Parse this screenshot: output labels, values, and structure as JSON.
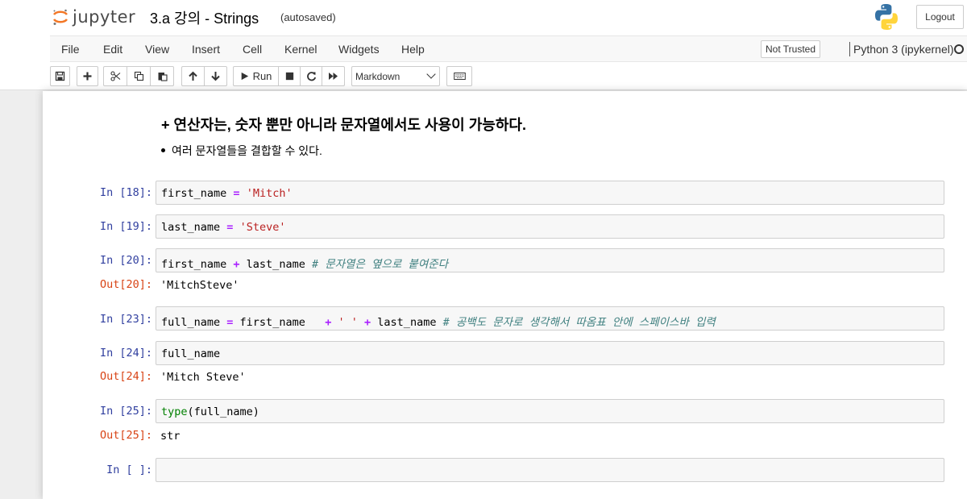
{
  "header": {
    "logo_text": "jupyter",
    "notebook_title": "3.a 강의 - Strings",
    "autosave_status": "(autosaved)",
    "logout_label": "Logout"
  },
  "menubar": {
    "items": [
      "File",
      "Edit",
      "View",
      "Insert",
      "Cell",
      "Kernel",
      "Widgets",
      "Help"
    ],
    "trust_status": "Not Trusted",
    "kernel_name": "Python 3 (ipykernel)"
  },
  "toolbar": {
    "buttons": [
      "save-icon",
      "add-icon",
      "cut-icon",
      "copy-icon",
      "paste-icon",
      "move-up-icon",
      "move-down-icon",
      "run-icon",
      "stop-icon",
      "restart-icon",
      "fast-forward-icon",
      "keyboard-icon"
    ],
    "run_label": "Run",
    "cell_type": "Markdown"
  },
  "markdown": {
    "heading": "+ 연산자는, 숫자 뿐만 아니라 문자열에서도 사용이 가능하다.",
    "bullet": "여러 문자열들을 결합할 수 있다."
  },
  "cells": [
    {
      "prompt": "In [18]:",
      "code": [
        {
          "text": "first_name ",
          "type": "plain"
        },
        {
          "text": "=",
          "type": "op"
        },
        {
          "text": " ",
          "type": "plain"
        },
        {
          "text": "'Mitch'",
          "type": "str"
        }
      ]
    },
    {
      "prompt": "In [19]:",
      "code": [
        {
          "text": "last_name ",
          "type": "plain"
        },
        {
          "text": "=",
          "type": "op"
        },
        {
          "text": " ",
          "type": "plain"
        },
        {
          "text": "'Steve'",
          "type": "str"
        }
      ]
    },
    {
      "prompt": "In [20]:",
      "code": [
        {
          "text": "first_name ",
          "type": "plain"
        },
        {
          "text": "+",
          "type": "op"
        },
        {
          "text": " last_name ",
          "type": "plain"
        },
        {
          "text": "# 문자열은 옆으로 붙여준다",
          "type": "comment"
        }
      ],
      "out_prompt": "Out[20]:",
      "output": "'MitchSteve'"
    },
    {
      "prompt": "In [23]:",
      "code": [
        {
          "text": "full_name ",
          "type": "plain"
        },
        {
          "text": "=",
          "type": "op"
        },
        {
          "text": " first_name   ",
          "type": "plain"
        },
        {
          "text": "+",
          "type": "op"
        },
        {
          "text": " ",
          "type": "plain"
        },
        {
          "text": "' '",
          "type": "str"
        },
        {
          "text": " ",
          "type": "plain"
        },
        {
          "text": "+",
          "type": "op"
        },
        {
          "text": " last_name ",
          "type": "plain"
        },
        {
          "text": "# 공백도 문자로 생각해서 따옴표 안에 스페이스바 입력",
          "type": "comment"
        }
      ]
    },
    {
      "prompt": "In [24]:",
      "code": [
        {
          "text": "full_name",
          "type": "plain"
        }
      ],
      "out_prompt": "Out[24]:",
      "output": "'Mitch Steve'"
    },
    {
      "prompt": "In [25]:",
      "code": [
        {
          "text": "type",
          "type": "builtin"
        },
        {
          "text": "(full_name)",
          "type": "plain"
        }
      ],
      "out_prompt": "Out[25]:",
      "output": "str"
    },
    {
      "prompt": "In [ ]:",
      "code": []
    }
  ],
  "colors": {
    "in_prompt": "#303f9f",
    "out_prompt": "#d84315",
    "string": "#ba2121",
    "operator": "#aa22ff",
    "comment": "#408080",
    "builtin": "#008000"
  }
}
